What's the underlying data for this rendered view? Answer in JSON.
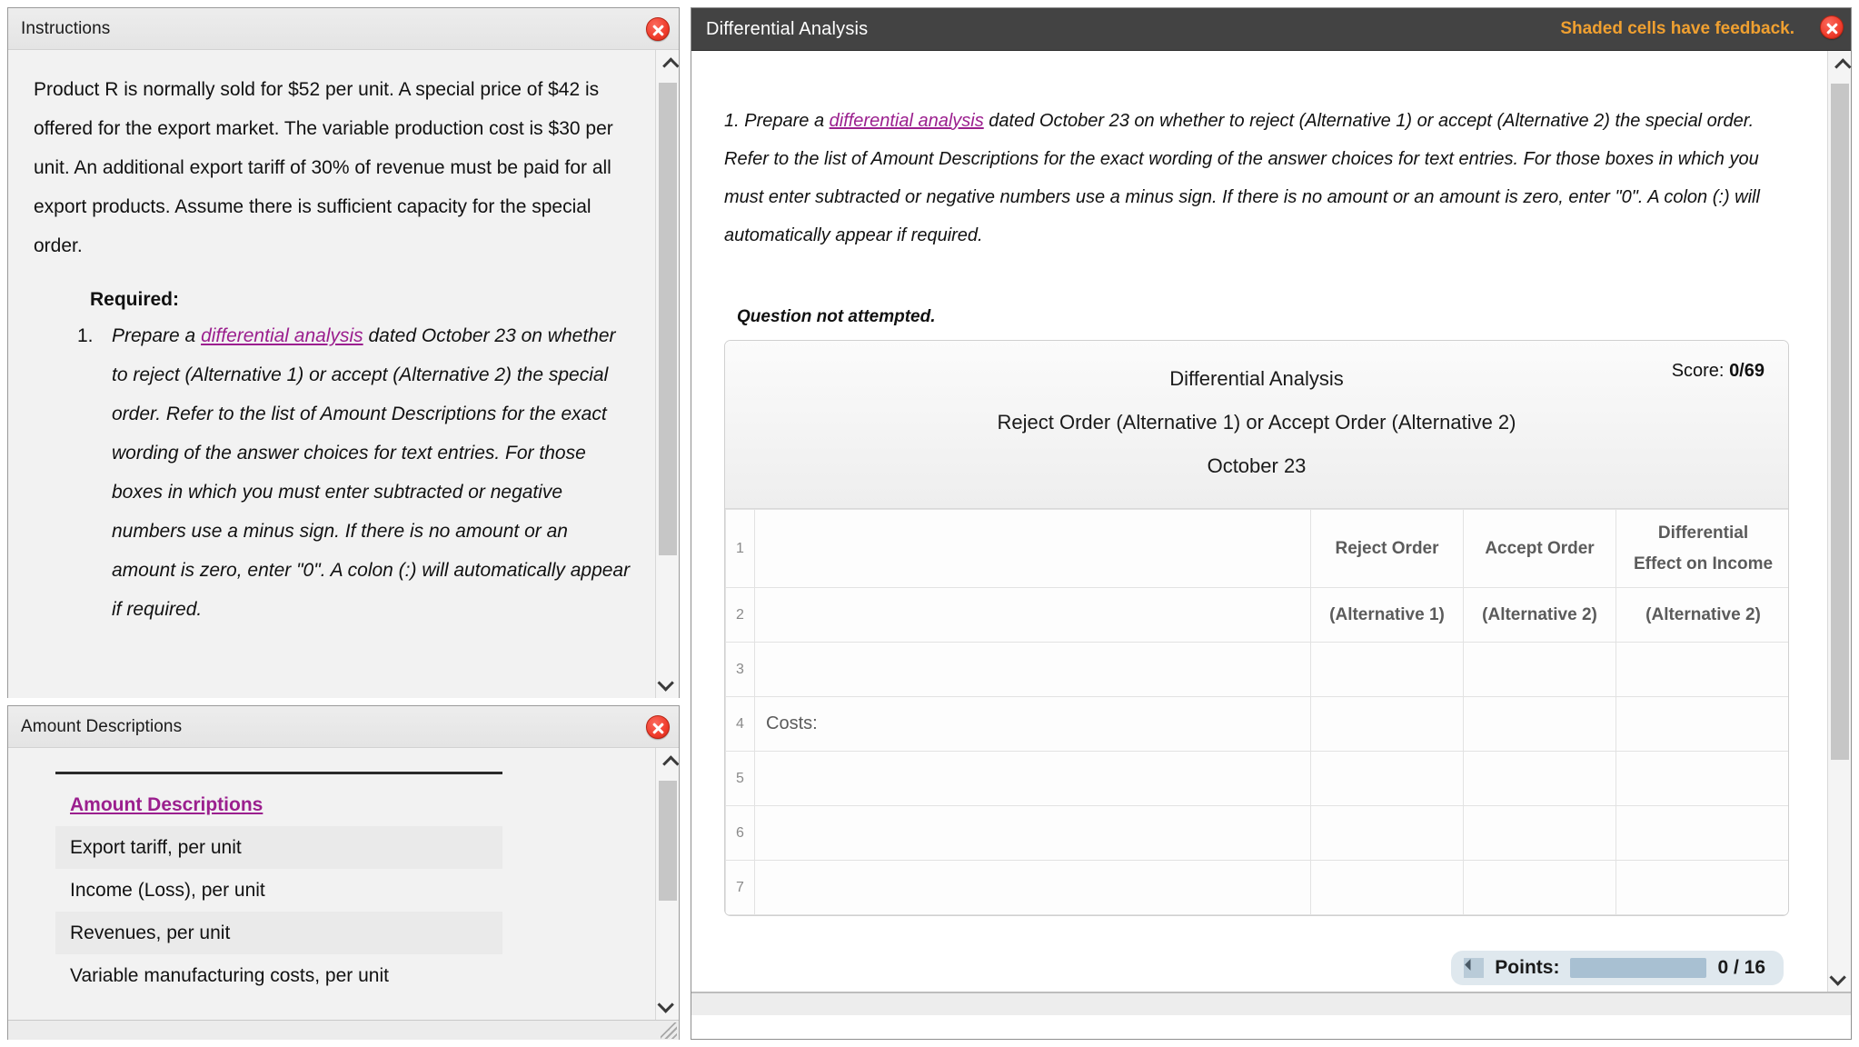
{
  "instructions": {
    "title": "Instructions",
    "paragraph": "Product R is normally sold for $52 per unit. A special price of $42 is offered for the export market. The variable production cost is $30 per unit. An additional export tariff of 30% of revenue must be paid for all export products. Assume there is sufficient capacity for the special order.",
    "required_label": "Required:",
    "item_number": "1.",
    "item_before_link": "Prepare a ",
    "item_link": "differential analysis",
    "item_after_link": " dated October 23 on whether to reject (Alternative 1) or accept (Alternative 2) the special order. Refer to the list of Amount Descriptions for the exact wording of the answer choices for text entries. For those boxes in which you must enter subtracted or negative numbers use a minus sign. If there is no amount or an amount is zero, enter \"0\". A colon (:) will automatically appear if required."
  },
  "amount_descriptions": {
    "title": "Amount Descriptions",
    "header": "Amount Descriptions",
    "items": [
      "Export tariff, per unit",
      "Income (Loss), per unit",
      "Revenues, per unit",
      "Variable manufacturing costs, per unit"
    ]
  },
  "main": {
    "title": "Differential Analysis",
    "feedback_note": "Shaded cells have feedback.",
    "requirement_before_link": "1. Prepare a ",
    "requirement_link": "differential analysis",
    "requirement_after_link": " dated October 23 on whether to reject (Alternative 1) or accept (Alternative 2) the special order. Refer to the list of Amount Descriptions for the exact wording of the answer choices for text entries. For those boxes in which you must enter subtracted or negative numbers use a minus sign. If there is no amount or an amount is zero, enter \"0\". A colon (:) will automatically appear if required.",
    "status_text": "Question not attempted.",
    "sheet": {
      "title_line1": "Differential Analysis",
      "title_line2": "Reject Order (Alternative 1) or Accept Order (Alternative 2)",
      "title_line3": "October 23",
      "score_label": "Score:",
      "score_value": "0/69",
      "col_headers": {
        "reject": "Reject Order",
        "accept": "Accept Order",
        "diff_line1": "Differential",
        "diff_line2": "Effect on Income"
      },
      "col_subheaders": {
        "reject": "(Alternative 1)",
        "accept": "(Alternative 2)",
        "diff": "(Alternative 2)"
      },
      "rows": [
        {
          "num": "1",
          "label": "",
          "reject": "",
          "accept": "",
          "diff": ""
        },
        {
          "num": "2",
          "label": "",
          "reject": "",
          "accept": "",
          "diff": ""
        },
        {
          "num": "3",
          "label": "",
          "reject": "",
          "accept": "",
          "diff": ""
        },
        {
          "num": "4",
          "label": "Costs:",
          "reject": "",
          "accept": "",
          "diff": ""
        },
        {
          "num": "5",
          "label": "",
          "reject": "",
          "accept": "",
          "diff": ""
        },
        {
          "num": "6",
          "label": "",
          "reject": "",
          "accept": "",
          "diff": ""
        },
        {
          "num": "7",
          "label": "",
          "reject": "",
          "accept": "",
          "diff": ""
        }
      ]
    },
    "points": {
      "label": "Points:",
      "value": "0 / 16"
    }
  },
  "colors": {
    "header_dark": "#434343",
    "feedback_orange": "#f0a030",
    "link_purple": "#9b1f8e",
    "close_red": "#ef3b2b",
    "points_bar": "#a8c0d2"
  }
}
